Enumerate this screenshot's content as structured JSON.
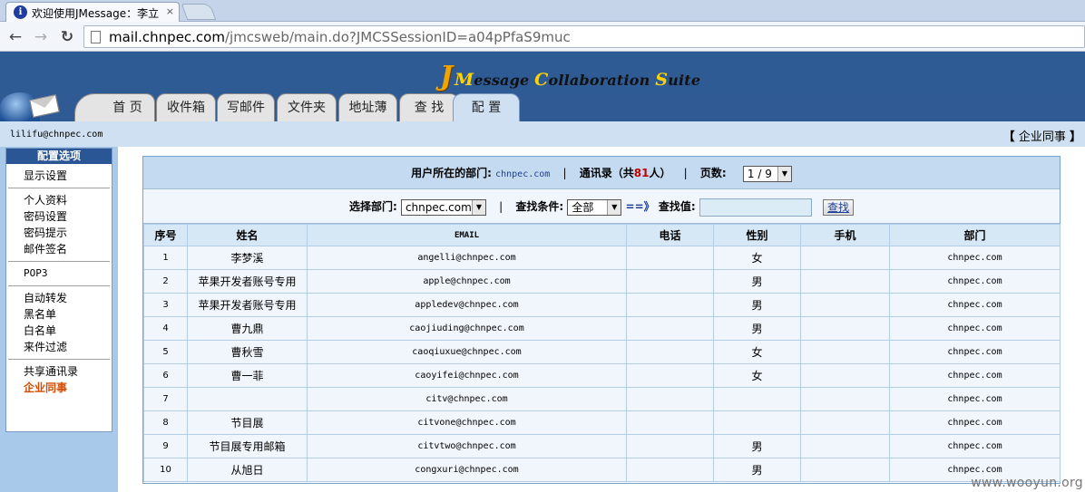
{
  "browser": {
    "tab_title": "欢迎使用JMessage：李立",
    "tab_close": "×",
    "nav_back": "←",
    "nav_forward": "→",
    "nav_reload": "↻",
    "url_host": "mail.chnpec.com",
    "url_path": "/jmcsweb/main.do?JMCSSessionID=a04pPfaS9muc"
  },
  "header": {
    "logo_j": "J",
    "logo_parts": [
      {
        "cap": "M",
        "rest": "essage "
      },
      {
        "cap": "C",
        "rest": "ollaboration "
      },
      {
        "cap": "S",
        "rest": "uite"
      }
    ],
    "tabs": [
      {
        "label": "首 页",
        "active": false
      },
      {
        "label": "收件箱",
        "active": false
      },
      {
        "label": "写邮件",
        "active": false
      },
      {
        "label": "文件夹",
        "active": false
      },
      {
        "label": "地址薄",
        "active": false
      },
      {
        "label": "查 找",
        "active": false
      },
      {
        "label": "配 置",
        "active": true
      }
    ]
  },
  "userbar": {
    "email": "lilifu@chnpec.com",
    "crumb_open": "【",
    "crumb_label": "企业同事",
    "crumb_close": "】"
  },
  "sidebar": {
    "title": "配置选项",
    "groups": [
      [
        "显示设置"
      ],
      [
        "个人资料",
        "密码设置",
        "密码提示",
        "邮件签名"
      ],
      [
        "POP3"
      ],
      [
        "自动转发",
        "黑名单",
        "白名单",
        "来件过滤"
      ],
      [
        "共享通讯录",
        "企业同事"
      ]
    ],
    "active_item": "企业同事"
  },
  "summary": {
    "dept_label": "用户所在的部门:",
    "dept_value": "chnpec.com",
    "sep": "|",
    "addr_label_pre": "通讯录（共",
    "addr_count": "81",
    "addr_label_post": "人）",
    "page_label": "页数:",
    "page_value": "1 / 9"
  },
  "filter": {
    "dept_label": "选择部门:",
    "dept_value": "chnpec.com",
    "sep": "|",
    "cond_label": "查找条件:",
    "cond_value": "全部",
    "arrows": "==》",
    "search_label": "查找值:",
    "search_value": "",
    "search_button": "查找"
  },
  "table": {
    "columns": [
      "序号",
      "姓名",
      "EMAIL",
      "电话",
      "性别",
      "手机",
      "部门"
    ],
    "rows": [
      {
        "no": "1",
        "name": "李梦溪",
        "email": "angelli@chnpec.com",
        "phone": "",
        "gender": "女",
        "mobile": "",
        "dept": "chnpec.com"
      },
      {
        "no": "2",
        "name": "苹果开发者账号专用",
        "email": "apple@chnpec.com",
        "phone": "",
        "gender": "男",
        "mobile": "",
        "dept": "chnpec.com"
      },
      {
        "no": "3",
        "name": "苹果开发者账号专用",
        "email": "appledev@chnpec.com",
        "phone": "",
        "gender": "男",
        "mobile": "",
        "dept": "chnpec.com"
      },
      {
        "no": "4",
        "name": "曹九鼎",
        "email": "caojiuding@chnpec.com",
        "phone": "",
        "gender": "男",
        "mobile": "",
        "dept": "chnpec.com"
      },
      {
        "no": "5",
        "name": "曹秋雪",
        "email": "caoqiuxue@chnpec.com",
        "phone": "",
        "gender": "女",
        "mobile": "",
        "dept": "chnpec.com"
      },
      {
        "no": "6",
        "name": "曹一菲",
        "email": "caoyifei@chnpec.com",
        "phone": "",
        "gender": "女",
        "mobile": "",
        "dept": "chnpec.com"
      },
      {
        "no": "7",
        "name": "",
        "email": "citv@chnpec.com",
        "phone": "",
        "gender": "",
        "mobile": "",
        "dept": "chnpec.com"
      },
      {
        "no": "8",
        "name": "节目展",
        "email": "citvone@chnpec.com",
        "phone": "",
        "gender": "",
        "mobile": "",
        "dept": "chnpec.com"
      },
      {
        "no": "9",
        "name": "节目展专用邮箱",
        "email": "citvtwo@chnpec.com",
        "phone": "",
        "gender": "男",
        "mobile": "",
        "dept": "chnpec.com"
      },
      {
        "no": "10",
        "name": "从旭日",
        "email": "congxuri@chnpec.com",
        "phone": "",
        "gender": "男",
        "mobile": "",
        "dept": "chnpec.com"
      }
    ]
  },
  "watermark": "www.wooyun.org",
  "colors": {
    "header_blue": "#2f5a93",
    "light_blue": "#cfe0f2",
    "active_item": "#d64a00",
    "count_red": "#c00000"
  }
}
